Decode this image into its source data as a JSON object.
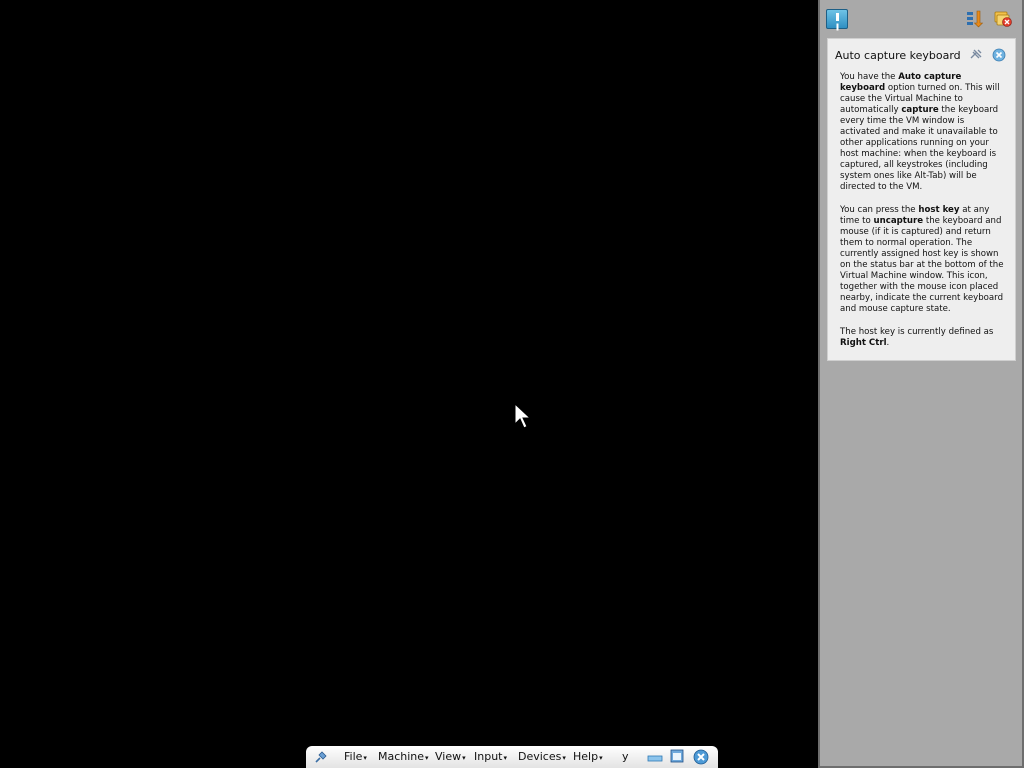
{
  "notification_center": {
    "note": {
      "title": "Auto capture keyboard ...",
      "p1": [
        {
          "text": "You have the ",
          "bold": false
        },
        {
          "text": "Auto capture keyboard",
          "bold": true
        },
        {
          "text": " option turned on. This will cause the Virtual Machine to automatically ",
          "bold": false
        },
        {
          "text": "capture",
          "bold": true
        },
        {
          "text": " the keyboard every time the VM window is activated and make it unavailable to other applications running on your host machine: when the keyboard is captured, all keystrokes (including system ones like Alt-Tab) will be directed to the VM.",
          "bold": false
        }
      ],
      "p2": [
        {
          "text": "You can press the ",
          "bold": false
        },
        {
          "text": "host key",
          "bold": true
        },
        {
          "text": " at any time to ",
          "bold": false
        },
        {
          "text": "uncapture",
          "bold": true
        },
        {
          "text": " the keyboard and mouse (if it is captured) and return them to normal operation. The currently assigned host key is shown on the status bar at the bottom of the Virtual Machine window. This icon, together with the mouse icon placed nearby, indicate the current keyboard and mouse capture state.",
          "bold": false
        }
      ],
      "p3": [
        {
          "text": "The host key is currently defined as ",
          "bold": false
        },
        {
          "text": "Right Ctrl",
          "bold": true
        },
        {
          "text": ".",
          "bold": false
        }
      ]
    }
  },
  "mini_toolbar": {
    "menus": [
      "File",
      "Machine",
      "View",
      "Input",
      "Devices",
      "Help"
    ],
    "extra_label": "y"
  },
  "colors": {
    "vm_background": "#000000",
    "panel_background": "#a9a9a9",
    "note_background": "#eeeeee",
    "accent_blue": "#2f8fc2"
  }
}
